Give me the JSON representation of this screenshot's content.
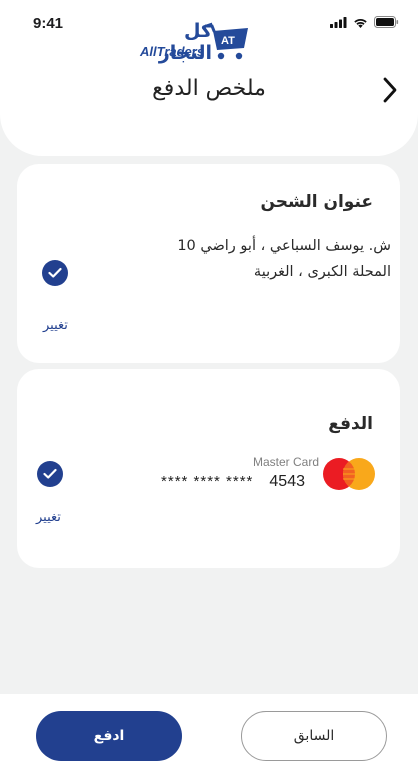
{
  "status_bar": {
    "time": "9:41"
  },
  "logo": {
    "arabic": "كل التجار",
    "english": "AllTraders",
    "badge": "AT"
  },
  "header": {
    "title": "ملخص الدفع"
  },
  "shipping": {
    "title": "عنوان الشحن",
    "address_line1": "ش. يوسف السباعي ، أبو راضي 10",
    "address_line2": "المحلة الكبرى ، الغربية",
    "change_label": "تغيير"
  },
  "payment": {
    "title": "الدفع",
    "card_brand": "Master Card",
    "card_mask": "****   ****   ****",
    "card_last4": "4543",
    "change_label": "تغيير"
  },
  "footer": {
    "pay_label": "ادفع",
    "previous_label": "السابق"
  },
  "colors": {
    "accent": "#22408f",
    "background": "#f1f2f2",
    "card": "#ffffff"
  }
}
